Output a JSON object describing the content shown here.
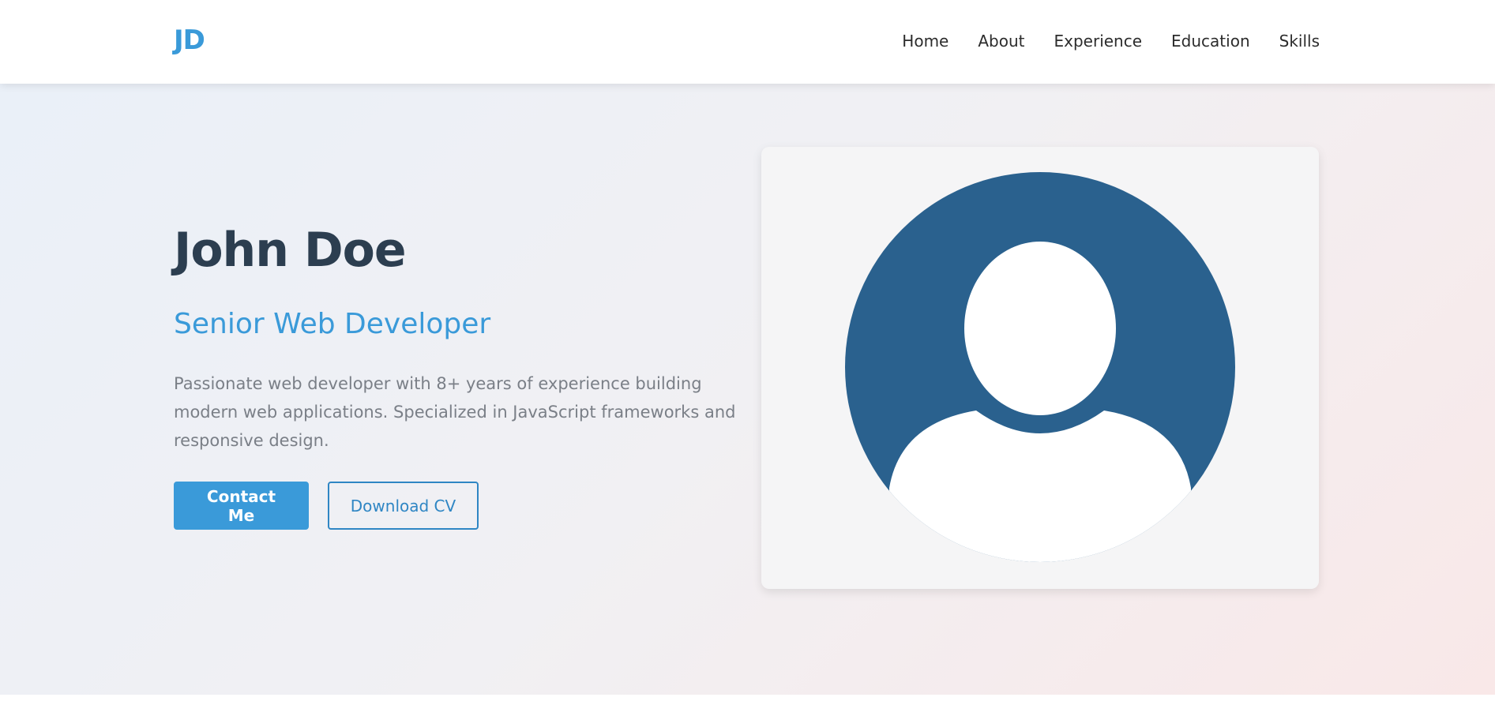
{
  "nav": {
    "logo": "JD",
    "links": [
      "Home",
      "About",
      "Experience",
      "Education",
      "Skills"
    ]
  },
  "hero": {
    "name": "John Doe",
    "title": "Senior Web Developer",
    "description": "Passionate web developer with 8+ years of experience building modern web applications. Specialized in JavaScript frameworks and responsive design.",
    "contact_label": "Contact Me",
    "download_label": "Download CV"
  },
  "colors": {
    "accent": "#3a9ad9",
    "heading": "#2c3e50",
    "avatar_bg": "#2a618e"
  },
  "icons": {
    "avatar": "user-silhouette-icon"
  }
}
